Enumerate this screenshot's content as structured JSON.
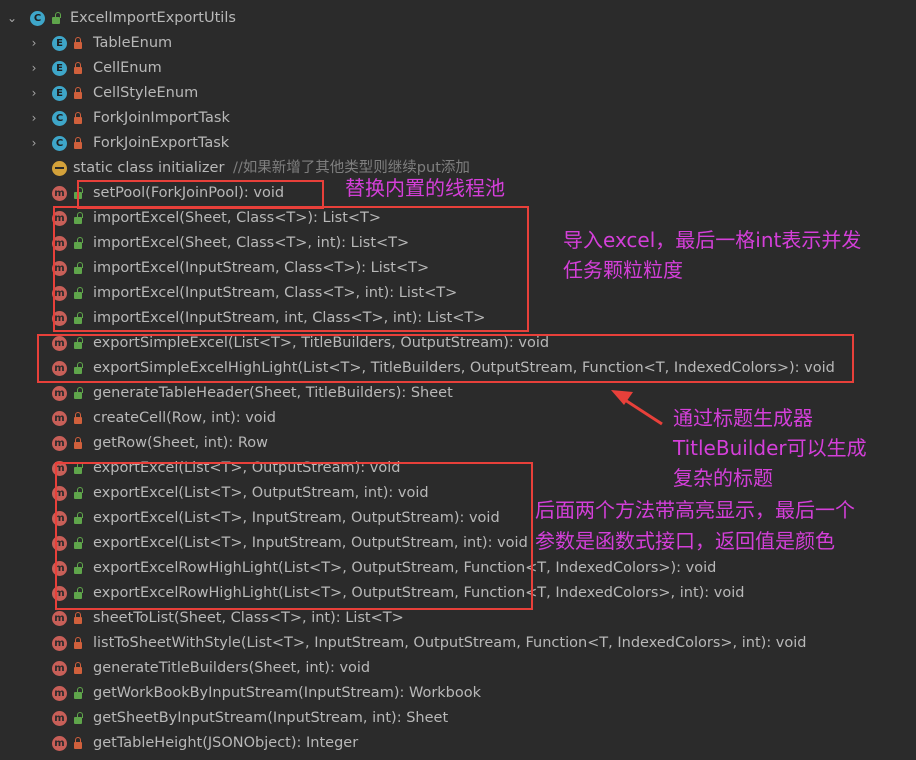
{
  "root": {
    "label": "ExcelImportExportUtils",
    "icon": "class-icon"
  },
  "inner": [
    {
      "label": "TableEnum",
      "icon": "enum-icon",
      "letter": "E"
    },
    {
      "label": "CellEnum",
      "icon": "enum-icon",
      "letter": "E"
    },
    {
      "label": "CellStyleEnum",
      "icon": "enum-icon",
      "letter": "E"
    },
    {
      "label": "ForkJoinImportTask",
      "icon": "class-icon",
      "letter": "C"
    },
    {
      "label": "ForkJoinExportTask",
      "icon": "class-icon",
      "letter": "C"
    }
  ],
  "initializer": {
    "label": "static class initializer",
    "comment": "//如果新增了其他类型则继续put添加"
  },
  "methods": [
    {
      "label": "setPool(ForkJoinPool): void",
      "access": "public"
    },
    {
      "label": "importExcel(Sheet, Class<T>): List<T>",
      "access": "public"
    },
    {
      "label": "importExcel(Sheet, Class<T>, int): List<T>",
      "access": "public"
    },
    {
      "label": "importExcel(InputStream, Class<T>): List<T>",
      "access": "public"
    },
    {
      "label": "importExcel(InputStream, Class<T>, int): List<T>",
      "access": "public"
    },
    {
      "label": "importExcel(InputStream, int, Class<T>, int): List<T>",
      "access": "public"
    },
    {
      "label": "exportSimpleExcel(List<T>, TitleBuilders, OutputStream): void",
      "access": "public"
    },
    {
      "label": "exportSimpleExcelHighLight(List<T>, TitleBuilders, OutputStream, Function<T, IndexedColors>): void",
      "access": "public"
    },
    {
      "label": "generateTableHeader(Sheet, TitleBuilders): Sheet",
      "access": "public"
    },
    {
      "label": "createCell(Row, int): void",
      "access": "private"
    },
    {
      "label": "getRow(Sheet, int): Row",
      "access": "private"
    },
    {
      "label": "exportExcel(List<T>, OutputStream): void",
      "access": "public"
    },
    {
      "label": "exportExcel(List<T>, OutputStream, int): void",
      "access": "public"
    },
    {
      "label": "exportExcel(List<T>, InputStream, OutputStream): void",
      "access": "public"
    },
    {
      "label": "exportExcel(List<T>, InputStream, OutputStream, int): void",
      "access": "public"
    },
    {
      "label": "exportExcelRowHighLight(List<T>, OutputStream, Function<T, IndexedColors>): void",
      "access": "public"
    },
    {
      "label": "exportExcelRowHighLight(List<T>, OutputStream, Function<T, IndexedColors>, int): void",
      "access": "public"
    },
    {
      "label": "sheetToList(Sheet, Class<T>, int): List<T>",
      "access": "private"
    },
    {
      "label": "listToSheetWithStyle(List<T>, InputStream, OutputStream, Function<T, IndexedColors>, int): void",
      "access": "private"
    },
    {
      "label": "generateTitleBuilders(Sheet, int): void",
      "access": "private"
    },
    {
      "label": "getWorkBookByInputStream(InputStream): Workbook",
      "access": "public"
    },
    {
      "label": "getSheetByInputStream(InputStream, int): Sheet",
      "access": "public"
    },
    {
      "label": "getTableHeight(JSONObject): Integer",
      "access": "private"
    }
  ],
  "annotations": {
    "pool": "替换内置的线程池",
    "import_line1": "导入excel，最后一格int表示并发",
    "import_line2": "任务颗粒粒度",
    "title_line1": "通过标题生成器",
    "title_line2": "TitleBuilder可以生成",
    "title_line3": "复杂的标题",
    "export_line1": "后面两个方法带高亮显示，最后一个",
    "export_line2": "参数是函数式接口，返回值是颜色"
  },
  "colors": {
    "background": "#2b2b2b",
    "text": "#b8b8b8",
    "annotation_box": "#e8403a",
    "annotation_text": "#d43fd9",
    "class_icon": "#3ea6c9",
    "method_icon": "#c85f58",
    "public_modifier": "#5fa54b",
    "private_modifier": "#d0603c"
  }
}
